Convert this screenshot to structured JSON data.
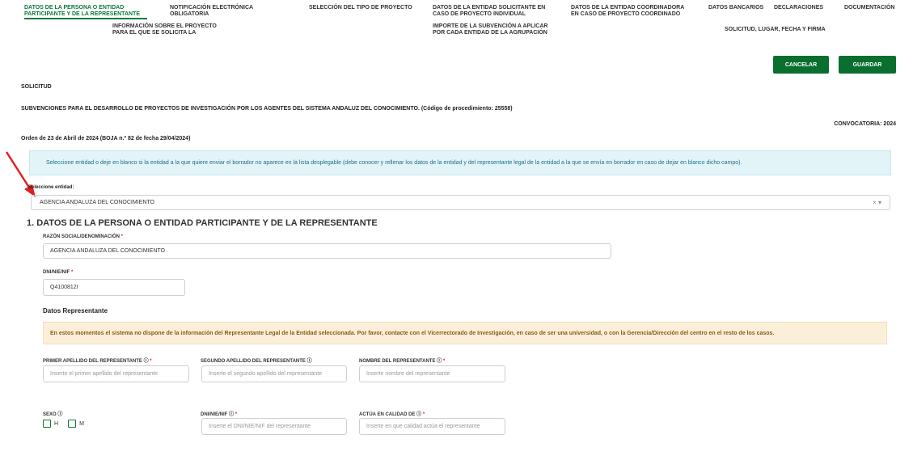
{
  "nav": [
    {
      "lines": [
        "Datos de la persona o entidad",
        "participante y de la representante"
      ],
      "active": true
    },
    {
      "lines": [
        "Notificación electrónica",
        "obligatoria"
      ],
      "active": false
    },
    {
      "lines": [
        "Selección del tipo de proyecto"
      ],
      "active": false
    },
    {
      "lines": [
        "Datos de la entidad solicitante en",
        "caso de proyecto individual"
      ],
      "active": false
    },
    {
      "lines": [
        "Datos de la entidad coordinadora",
        "en caso de proyecto coordinado"
      ],
      "active": false
    },
    {
      "lines": [
        "Datos bancarios"
      ],
      "active": false
    },
    {
      "lines": [
        "Declaraciones"
      ],
      "active": false
    },
    {
      "lines": [
        "Documentación"
      ],
      "active": false
    },
    {
      "lines": [
        "Información sobre el proyecto",
        "para el que se solicita la"
      ],
      "active": false
    },
    {
      "lines": [
        "Importe de la subvención a aplicar",
        "por cada entidad de la agrupación"
      ],
      "active": false
    },
    {
      "lines": [
        "Solicitud, lugar, fecha y firma"
      ],
      "active": false
    }
  ],
  "buttons": {
    "cancel": "CANCELAR",
    "save": "GUARDAR"
  },
  "header": {
    "solicitud": "SOLICITUD",
    "subvenciones": "SUBVENCIONES PARA EL DESARROLLO DE PROYECTOS DE INVESTIGACIÓN POR LOS AGENTES DEL SISTEMA ANDALUZ DEL CONOCIMIENTO. (Código de procedimiento: 25558)",
    "convocatoria": "CONVOCATORIA: 2024",
    "orden": "Orden de 23 de Abril de 2024 (BOJA n.º 82 de fecha 29/04/2024)"
  },
  "info_alert": "Seleccione entidad o deje en blanco si la entidad a la que quiere enviar el borrador no aparece en la lista desplegable (debe conocer y rellenar los datos de la entidad y del representante legal de la entidad a la que se envía en borrador en caso de dejar en blanco dicho campo).",
  "entity_select": {
    "label": "Seleccione entidad:",
    "value": "AGENCIA ANDALUZA DEL CONOCIMIENTO",
    "clear": "×",
    "caret": "▾"
  },
  "section1": {
    "title": "1. DATOS DE LA PERSONA O ENTIDAD PARTICIPANTE Y DE LA REPRESENTANTE",
    "razon_label": "RAZÓN SOCIAL/DENOMINACIÓN",
    "razon_value": "AGENCIA ANDALUZA DEL CONOCIMIENTO",
    "dni_label": "DNI/NIE/NIF",
    "dni_value": "Q4100812I",
    "req": "*"
  },
  "representante": {
    "title": "Datos Representante",
    "warning": "En estos momentos el sistema no dispone de la información del Representante Legal de la Entidad seleccionada. Por favor, contacte con el Vicerrectorado de Investigación, en caso de ser una universidad, o con la Gerencia/Dirección del centro en el resto de los casos.",
    "info_icon": "ⓘ",
    "primer_label": "PRIMER APELLIDO DEL REPRESENTANTE",
    "primer_ph": "Inserte el primer apellido del representante",
    "segundo_label": "SEGUNDO APELLIDO DEL REPRESENTANTE",
    "segundo_ph": "Inserte el segundo apellido del representante",
    "nombre_label": "NOMBRE DEL REPRESENTANTE",
    "nombre_ph": "Inserte nombre del representante",
    "sexo_label": "SEXO",
    "sexo_h": "H",
    "sexo_m": "M",
    "dni_label": "DNI/NIE/NIF",
    "dni_ph": "Inserte el DNI/NIE/NIF del representante",
    "calidad_label": "ACTÚA EN CALIDAD DE",
    "calidad_ph": "Inserte en que calidad actúa el representante"
  },
  "colors": {
    "accent": "#0a6e2f",
    "arrow": "#e02020"
  }
}
